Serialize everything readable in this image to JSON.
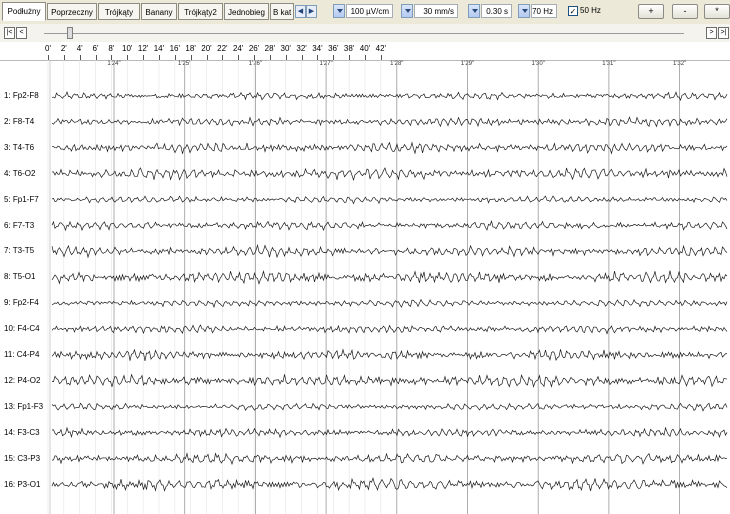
{
  "toolbar": {
    "tabs": [
      "Podłużny",
      "Poprzeczny",
      "Trójkąty",
      "Banany",
      "Trójkąty2",
      "Jednobieg",
      "B kat"
    ],
    "tab_nav": [
      "◀",
      "▶"
    ],
    "sensitivity": "100 µV/cm",
    "speed": "30 mm/s",
    "time_constant": "0.30 s",
    "high_filter": "70 Hz",
    "notch_checked": "✓",
    "notch_label": "50 Hz",
    "buttons": [
      "+",
      "-",
      "*"
    ]
  },
  "navigation": {
    "buttons": [
      "|<",
      "<",
      ">",
      ">|"
    ]
  },
  "ruler": {
    "ticks": [
      "0'",
      "2'",
      "4'",
      "6'",
      "8'",
      "10'",
      "12'",
      "14'",
      "16'",
      "18'",
      "20'",
      "22'",
      "24'",
      "26'",
      "28'",
      "30'",
      "32'",
      "34'",
      "36'",
      "38'",
      "40'",
      "42'"
    ],
    "minutes": [
      "1'24\"",
      "1'25\"",
      "1'26\"",
      "1'27\"",
      "1'28\"",
      "1'29\"",
      "1'30\"",
      "1'31\"",
      "1'32\""
    ]
  },
  "channels": [
    "1: Fp2-F8",
    "2: F8-T4",
    "3: T4-T6",
    "4: T6-O2",
    "5: Fp1-F7",
    "6: F7-T3",
    "7: T3-T5",
    "8: T5-O1",
    "9: Fp2-F4",
    "10: F4-C4",
    "11: C4-P4",
    "12: P4-O2",
    "13: Fp1-F3",
    "14: F3-C3",
    "15: C3-P3",
    "16: P3-O1"
  ]
}
